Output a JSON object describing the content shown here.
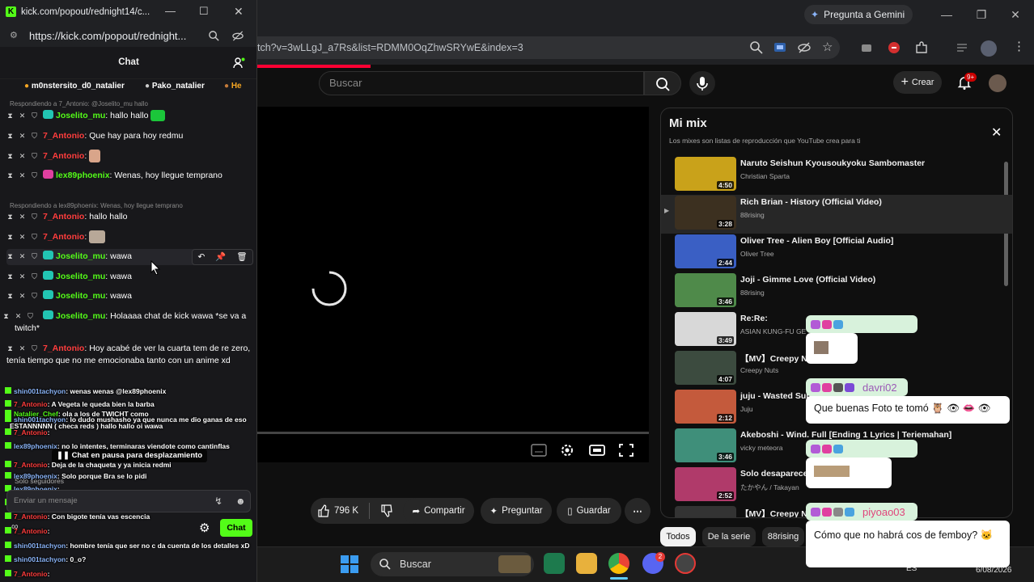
{
  "browser": {
    "gemini_label": "Pregunta a Gemini",
    "url_fragment": "tch?v=3wLLgJ_a7Rs&list=RDMM0OqZhwSRYwE&index=3"
  },
  "youtube": {
    "search_placeholder": "Buscar",
    "create_label": "Crear",
    "notif_count": "9+",
    "likes": "796 K",
    "share_label": "Compartir",
    "ask_label": "Preguntar",
    "save_label": "Guardar",
    "filters": [
      "Todos",
      "De la serie",
      "88rising"
    ],
    "mix": {
      "title": "Mi mix",
      "subtitle": "Los mixes son listas de reproducción que YouTube crea para ti",
      "items": [
        {
          "title": "Naruto Seishun Kyousoukyoku Sambomaster",
          "channel": "Christian Sparta",
          "duration": "4:50",
          "color": "#c9a21a"
        },
        {
          "title": "Rich Brian - History (Official Video)",
          "channel": "88rising",
          "duration": "3:28",
          "color": "#3c3020"
        },
        {
          "title": "Oliver Tree - Alien Boy [Official Audio]",
          "channel": "Oliver Tree",
          "duration": "2:44",
          "color": "#3a5fc4"
        },
        {
          "title": "Joji - Gimme Love (Official Video)",
          "channel": "88rising",
          "duration": "3:46",
          "color": "#4f8a4a"
        },
        {
          "title": "Re:Re:",
          "channel": "ASIAN KUNG-FU GE",
          "duration": "3:49",
          "color": "#d8d8d8"
        },
        {
          "title": "【MV】Creepy N",
          "channel": "Creepy Nuts",
          "duration": "4:07",
          "color": "#3c4b3f"
        },
        {
          "title": "juju - Wasted Sun",
          "channel": "Juju",
          "duration": "2:12",
          "color": "#c45a3c"
        },
        {
          "title": "Akeboshi - Wind. Full [Ending 1 Lyrics | Teriemahan]",
          "channel": "vicky meteora",
          "duration": "3:46",
          "color": "#3f8f7a"
        },
        {
          "title": "Solo desaparece",
          "channel": "たかやん / Takayan",
          "duration": "2:52",
          "color": "#b03a6a"
        },
        {
          "title": "【MV】Creepy N",
          "channel": "",
          "duration": "",
          "color": "#333"
        }
      ]
    }
  },
  "kick": {
    "window_title": "kick.com/popout/rednight14/c...",
    "url": "https://kick.com/popout/rednight...",
    "chat_title": "Chat",
    "pins": [
      "m0nstersito_d0_natalier",
      "Pako_natalier",
      "He"
    ],
    "replies": [
      "Respondiendo a 7_Antonio: @Joselito_mu hallo",
      "Respondiendo a lex89phoenix: Wenas, hoy llegue temprano"
    ],
    "messages": [
      {
        "user": "Joselito_mu",
        "text": "hallo hallo"
      },
      {
        "user": "7_Antonio",
        "text": "Que hay para hoy redmu"
      },
      {
        "user": "7_Antonio",
        "text": ""
      },
      {
        "user": "lex89phoenix",
        "text": "Wenas, hoy llegue temprano"
      },
      {
        "user": "7_Antonio",
        "text": "hallo hallo"
      },
      {
        "user": "7_Antonio",
        "text": ""
      },
      {
        "user": "Joselito_mu",
        "text": "wawa"
      },
      {
        "user": "Joselito_mu",
        "text": "wawa"
      },
      {
        "user": "Joselito_mu",
        "text": "wawa"
      },
      {
        "user": "Joselito_mu",
        "text": "Holaaaa chat de kick wawa *se va a twitch*"
      },
      {
        "user": "7_Antonio",
        "text": "Hoy acabé de ver la cuarta tem de re zero, tenía tiempo que no me emocionaba tanto con un anime xd"
      }
    ],
    "overlay": [
      {
        "user": "shin001tachyon",
        "text": "wenas wenas @lex89phoenix"
      },
      {
        "user": "7_Antonio",
        "text": "A Vegeta le queda bien la barba"
      },
      {
        "user": "Natalier_Chef",
        "text": "ola a los de TWICHT como"
      },
      {
        "user": "shin001tachyon",
        "text": "lo dudo mushasho ya que nunca me dio ganas de eso"
      },
      {
        "user": "",
        "text": "ESTANNNNN ( checa reds ) hallo hallo oi wawa"
      },
      {
        "user": "7_Antonio",
        "text": ""
      },
      {
        "user": "lex89phoenix",
        "text": "no lo intentes, terminaras viendote como cantinflas"
      },
      {
        "user": "7_Antonio",
        "text": "Deja de la chaqueta y ya inicia redmi"
      },
      {
        "user": "lex89phoenix",
        "text": "Solo porque Bra se lo pidi"
      },
      {
        "user": "lex89phoenix",
        "text": ""
      },
      {
        "user": "shin001tachyon",
        "text": "jajaja"
      },
      {
        "user": "7_Antonio",
        "text": "Con bigote tenía vas escencia"
      },
      {
        "user": "7_Antonio",
        "text": ""
      },
      {
        "user": "shin001tachyon",
        "text": "hombre tenía que ser no c da cuenta de los detalles xD"
      },
      {
        "user": "shin001tachyon",
        "text": "0_o?"
      },
      {
        "user": "7_Antonio",
        "text": ""
      }
    ],
    "paused_label": "Chat en pausa para desplazamiento",
    "followers_only": "Solo seguidores",
    "input_placeholder": "Enviar un mensaje",
    "send_label": "Chat"
  },
  "bubbles": [
    {
      "user": "",
      "text": ""
    },
    {
      "user": "davri02",
      "text": "Que buenas Foto te tomó 🦉 👁 👄 👁"
    },
    {
      "user": "",
      "text": ""
    },
    {
      "user": "piyoao03",
      "text": "Cómo que no habrá cos de femboy? 🐱"
    }
  ],
  "taskbar": {
    "search_label": "Buscar",
    "lang": "ES",
    "date": "6/08/2026",
    "discord_badge": "2"
  }
}
